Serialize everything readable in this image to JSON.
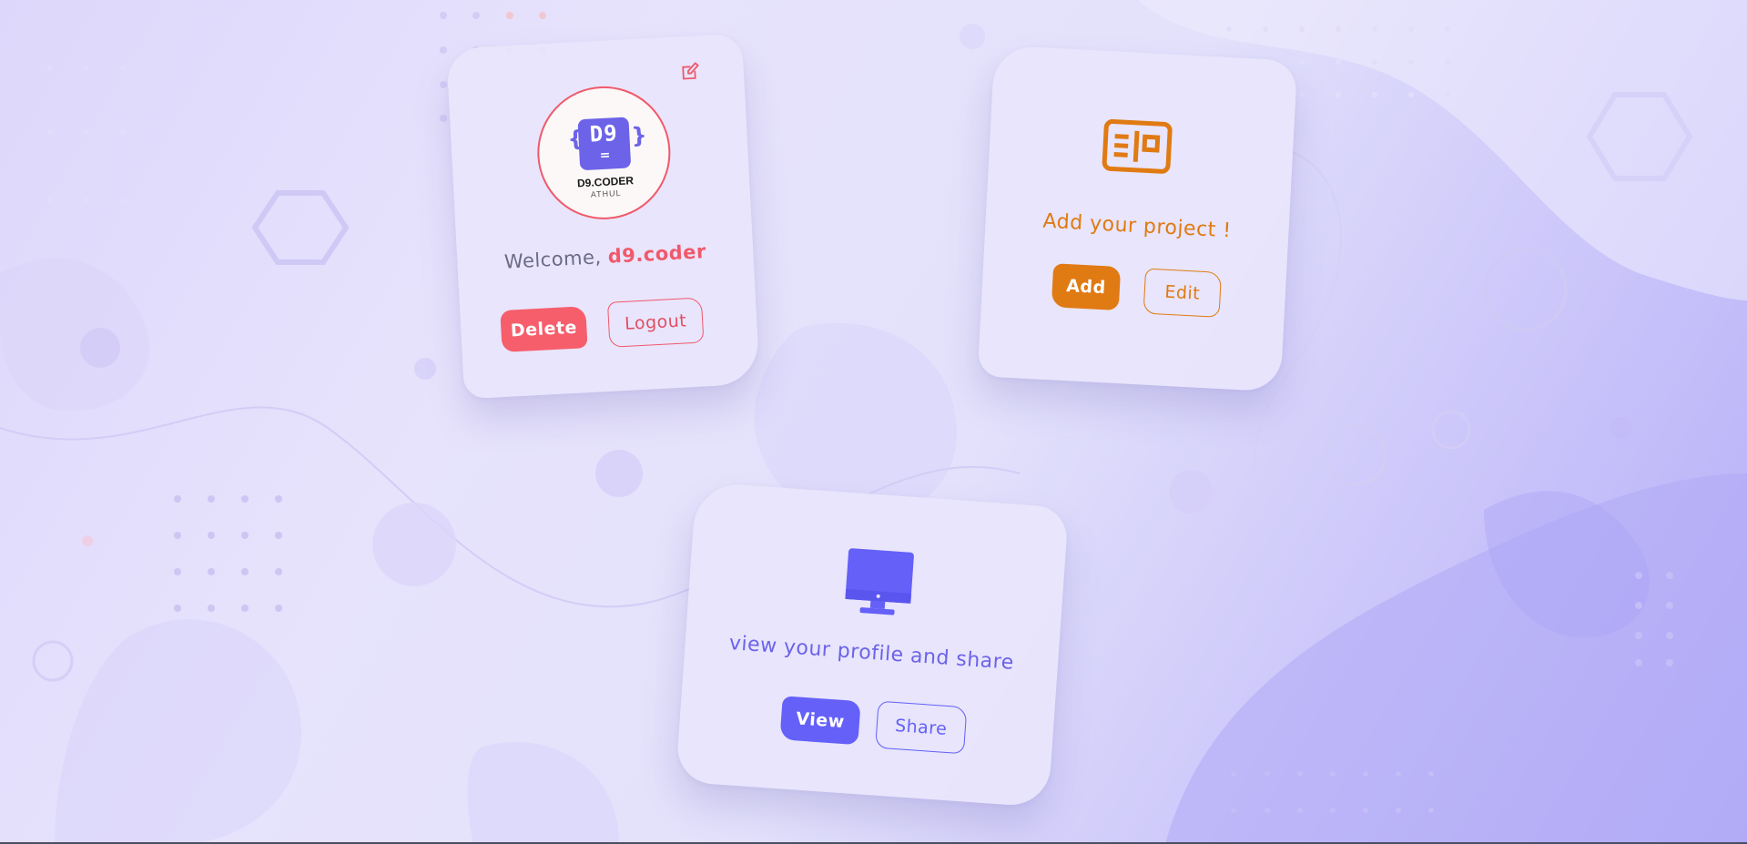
{
  "colors": {
    "profile_accent": "#f0596b",
    "project_accent": "#e07a12",
    "share_accent": "#6460f8"
  },
  "profile_card": {
    "edit_icon": "edit-icon",
    "avatar": {
      "logo_text": "D9",
      "name": "D9.CODER",
      "subtitle": "ATHUL"
    },
    "welcome_prefix": "Welcome,",
    "username": "d9.coder",
    "delete_label": "Delete",
    "logout_label": "Logout"
  },
  "project_card": {
    "icon": "project-card-icon",
    "title": "Add your project !",
    "add_label": "Add",
    "edit_label": "Edit"
  },
  "share_card": {
    "icon": "monitor-icon",
    "title": "view your profile and share",
    "view_label": "View",
    "share_label": "Share"
  }
}
